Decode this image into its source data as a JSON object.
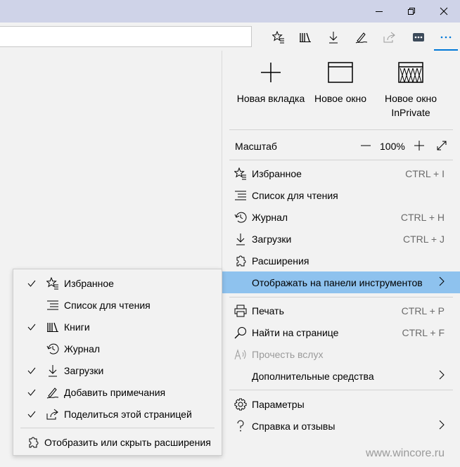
{
  "window": {
    "controls": [
      "minimize",
      "restore",
      "close"
    ]
  },
  "toolbar": {
    "icons": [
      "favorites-bar-icon",
      "books-icon",
      "downloads-icon",
      "notes-icon",
      "share-icon",
      "extension-icon",
      "more-icon"
    ]
  },
  "quick_actions": [
    {
      "label": "Новая вкладка",
      "icon": "plus-icon"
    },
    {
      "label": "Новое окно",
      "icon": "window-icon"
    },
    {
      "label": "Новое окно InPrivate",
      "icon": "inprivate-window-icon"
    }
  ],
  "zoom": {
    "label": "Масштаб",
    "minus": "—",
    "value": "100%",
    "plus": "+"
  },
  "menu_items": [
    {
      "label": "Избранное",
      "shortcut": "CTRL + I",
      "icon": "favorites-icon"
    },
    {
      "label": "Список для чтения",
      "shortcut": "",
      "icon": "reading-list-icon"
    },
    {
      "label": "Журнал",
      "shortcut": "CTRL + H",
      "icon": "history-icon"
    },
    {
      "label": "Загрузки",
      "shortcut": "CTRL + J",
      "icon": "downloads-icon"
    },
    {
      "label": "Расширения",
      "shortcut": "",
      "icon": "extensions-icon"
    },
    {
      "label": "Отображать на панели инструментов",
      "shortcut": "",
      "icon": ""
    },
    {
      "label": "Печать",
      "shortcut": "CTRL + P",
      "icon": "print-icon"
    },
    {
      "label": "Найти на странице",
      "shortcut": "CTRL + F",
      "icon": "find-icon"
    },
    {
      "label": "Прочесть вслух",
      "shortcut": "",
      "icon": "read-aloud-icon"
    },
    {
      "label": "Дополнительные средства",
      "shortcut": "",
      "icon": ""
    },
    {
      "label": "Параметры",
      "shortcut": "",
      "icon": "settings-icon"
    },
    {
      "label": "Справка и отзывы",
      "shortcut": "",
      "icon": "help-icon"
    }
  ],
  "submenu_items": [
    {
      "label": "Избранное",
      "checked": true,
      "icon": "favorites-icon"
    },
    {
      "label": "Список для чтения",
      "checked": false,
      "icon": "reading-list-icon"
    },
    {
      "label": "Книги",
      "checked": true,
      "icon": "books-icon"
    },
    {
      "label": "Журнал",
      "checked": false,
      "icon": "history-icon"
    },
    {
      "label": "Загрузки",
      "checked": true,
      "icon": "downloads-icon"
    },
    {
      "label": "Добавить примечания",
      "checked": true,
      "icon": "notes-icon"
    },
    {
      "label": "Поделиться этой страницей",
      "checked": true,
      "icon": "share-icon"
    },
    {
      "label": "Отобразить или скрыть расширения",
      "checked": false,
      "icon": "extensions-icon"
    }
  ],
  "watermark": "www.wincore.ru",
  "colors": {
    "highlight": "#8ec2ee",
    "accent": "#0078d7",
    "titlebar": "#cfd3e8"
  }
}
